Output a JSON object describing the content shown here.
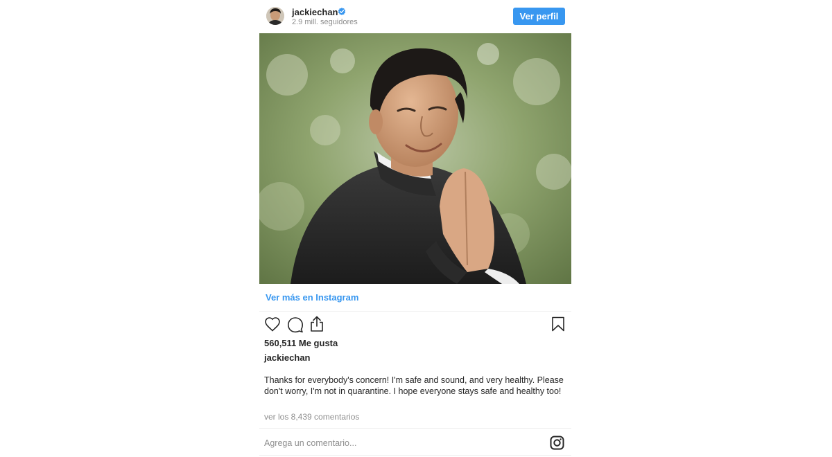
{
  "header": {
    "username": "jackiechan",
    "followers": "2.9 mill. seguidores",
    "view_profile_label": "Ver perfil"
  },
  "post": {
    "view_more_label": "Ver más en Instagram",
    "likes": "560,511 Me gusta",
    "caption_user": "jackiechan",
    "caption": "Thanks for everybody's concern! I'm safe and sound, and very healthy. Please don't worry, I'm not in quarantine. I hope everyone stays safe and healthy too!",
    "comments_link": "ver los 8,439 comentarios",
    "comment_placeholder": "Agrega un comentario..."
  },
  "icons": {
    "verified": "verified-badge-icon",
    "like": "heart-icon",
    "comment": "comment-bubble-icon",
    "share": "share-icon",
    "save": "bookmark-icon",
    "instagram": "instagram-logo-icon"
  },
  "colors": {
    "accent": "#3897f0",
    "text": "#262626",
    "muted": "#8e8e8e",
    "divider": "#efefef"
  }
}
